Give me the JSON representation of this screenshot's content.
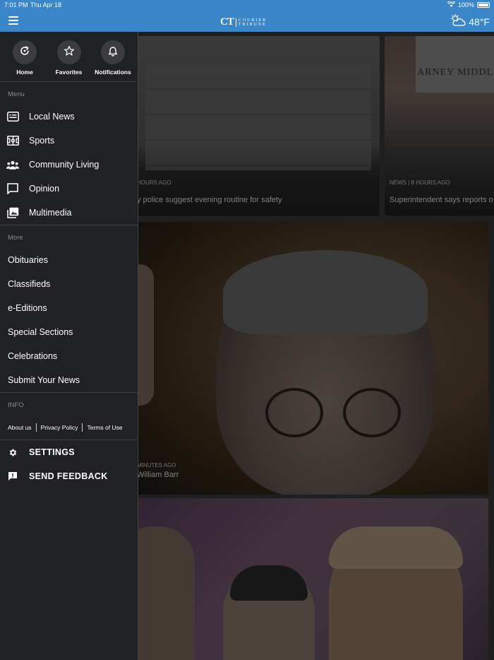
{
  "status_bar": {
    "time": "7:01 PM",
    "date": "Thu Apr 18",
    "battery": "100%"
  },
  "header": {
    "logo_mark": "CT",
    "logo_line1": "COURIER",
    "logo_line2": "TRIBUNE",
    "temperature": "48°F"
  },
  "quick_actions": [
    {
      "label": "Home",
      "icon": "refresh-icon"
    },
    {
      "label": "Favorites",
      "icon": "star-icon"
    },
    {
      "label": "Notifications",
      "icon": "bell-icon"
    }
  ],
  "menu": {
    "label": "Menu",
    "items": [
      {
        "label": "Local News",
        "icon": "newspaper-icon"
      },
      {
        "label": "Sports",
        "icon": "soccer-field-icon"
      },
      {
        "label": "Community Living",
        "icon": "group-icon"
      },
      {
        "label": "Opinion",
        "icon": "speech-bubble-icon"
      },
      {
        "label": "Multimedia",
        "icon": "photo-library-icon"
      }
    ]
  },
  "more": {
    "label": "More",
    "items": [
      "Obituaries",
      "Classifieds",
      "e-Editions",
      "Special Sections",
      "Celebrations",
      "Submit Your News"
    ]
  },
  "info": {
    "label": "INFO",
    "links": [
      "About us",
      "Privacy Policy",
      "Terms of Use"
    ]
  },
  "settings_label": "SETTINGS",
  "feedback_label": "SEND FEEDBACK",
  "cards": [
    {
      "meta": "HOURS AGO",
      "headline": "y police suggest evening routine for safety"
    },
    {
      "meta": "NEWS | 8 HOURS AGO",
      "headline": "Superintendent says reports o",
      "sign": "ARNEY  MIDDL"
    },
    {
      "meta": "MINUTES AGO",
      "headline": "William Barr"
    }
  ]
}
